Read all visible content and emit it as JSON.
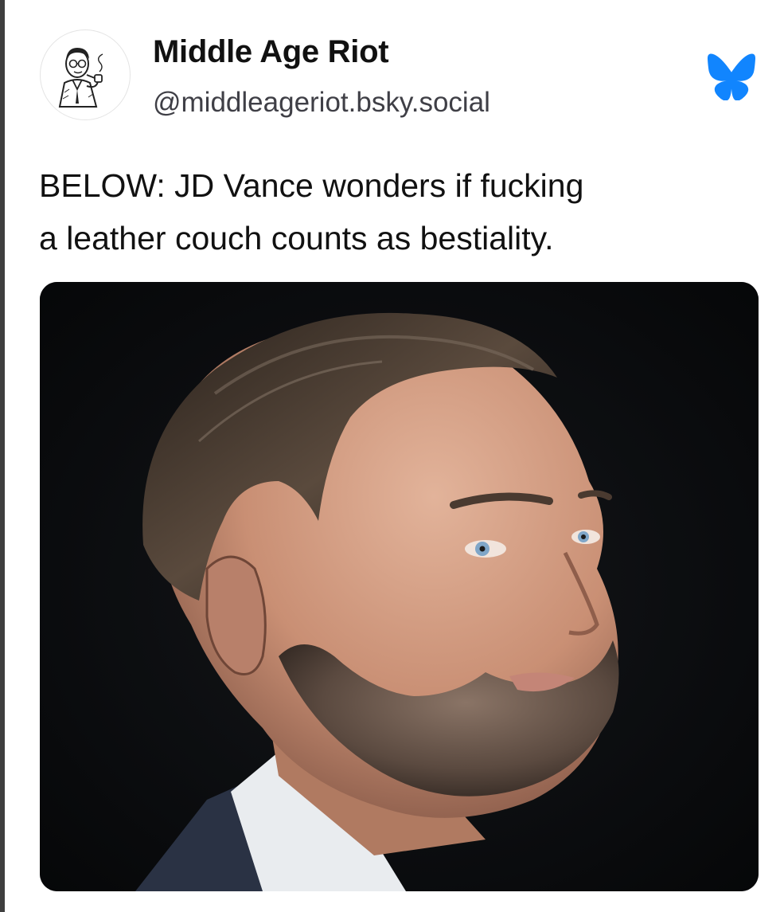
{
  "post": {
    "author": {
      "display_name": "Middle Age Riot",
      "handle": "@middleageriot.bsky.social",
      "avatar_icon": "vintage-man-smoking-pipe-illustration"
    },
    "platform_icon": "bluesky-butterfly-icon",
    "text_lines": [
      "BELOW: JD Vance wonders if fucking",
      "a leather couch counts as bestiality."
    ],
    "media": {
      "type": "photo"
    }
  },
  "colors": {
    "bluesky_blue": "#1185fe",
    "text_primary": "#111111",
    "text_secondary": "#3f3f46",
    "photo_background": "#07080a"
  }
}
